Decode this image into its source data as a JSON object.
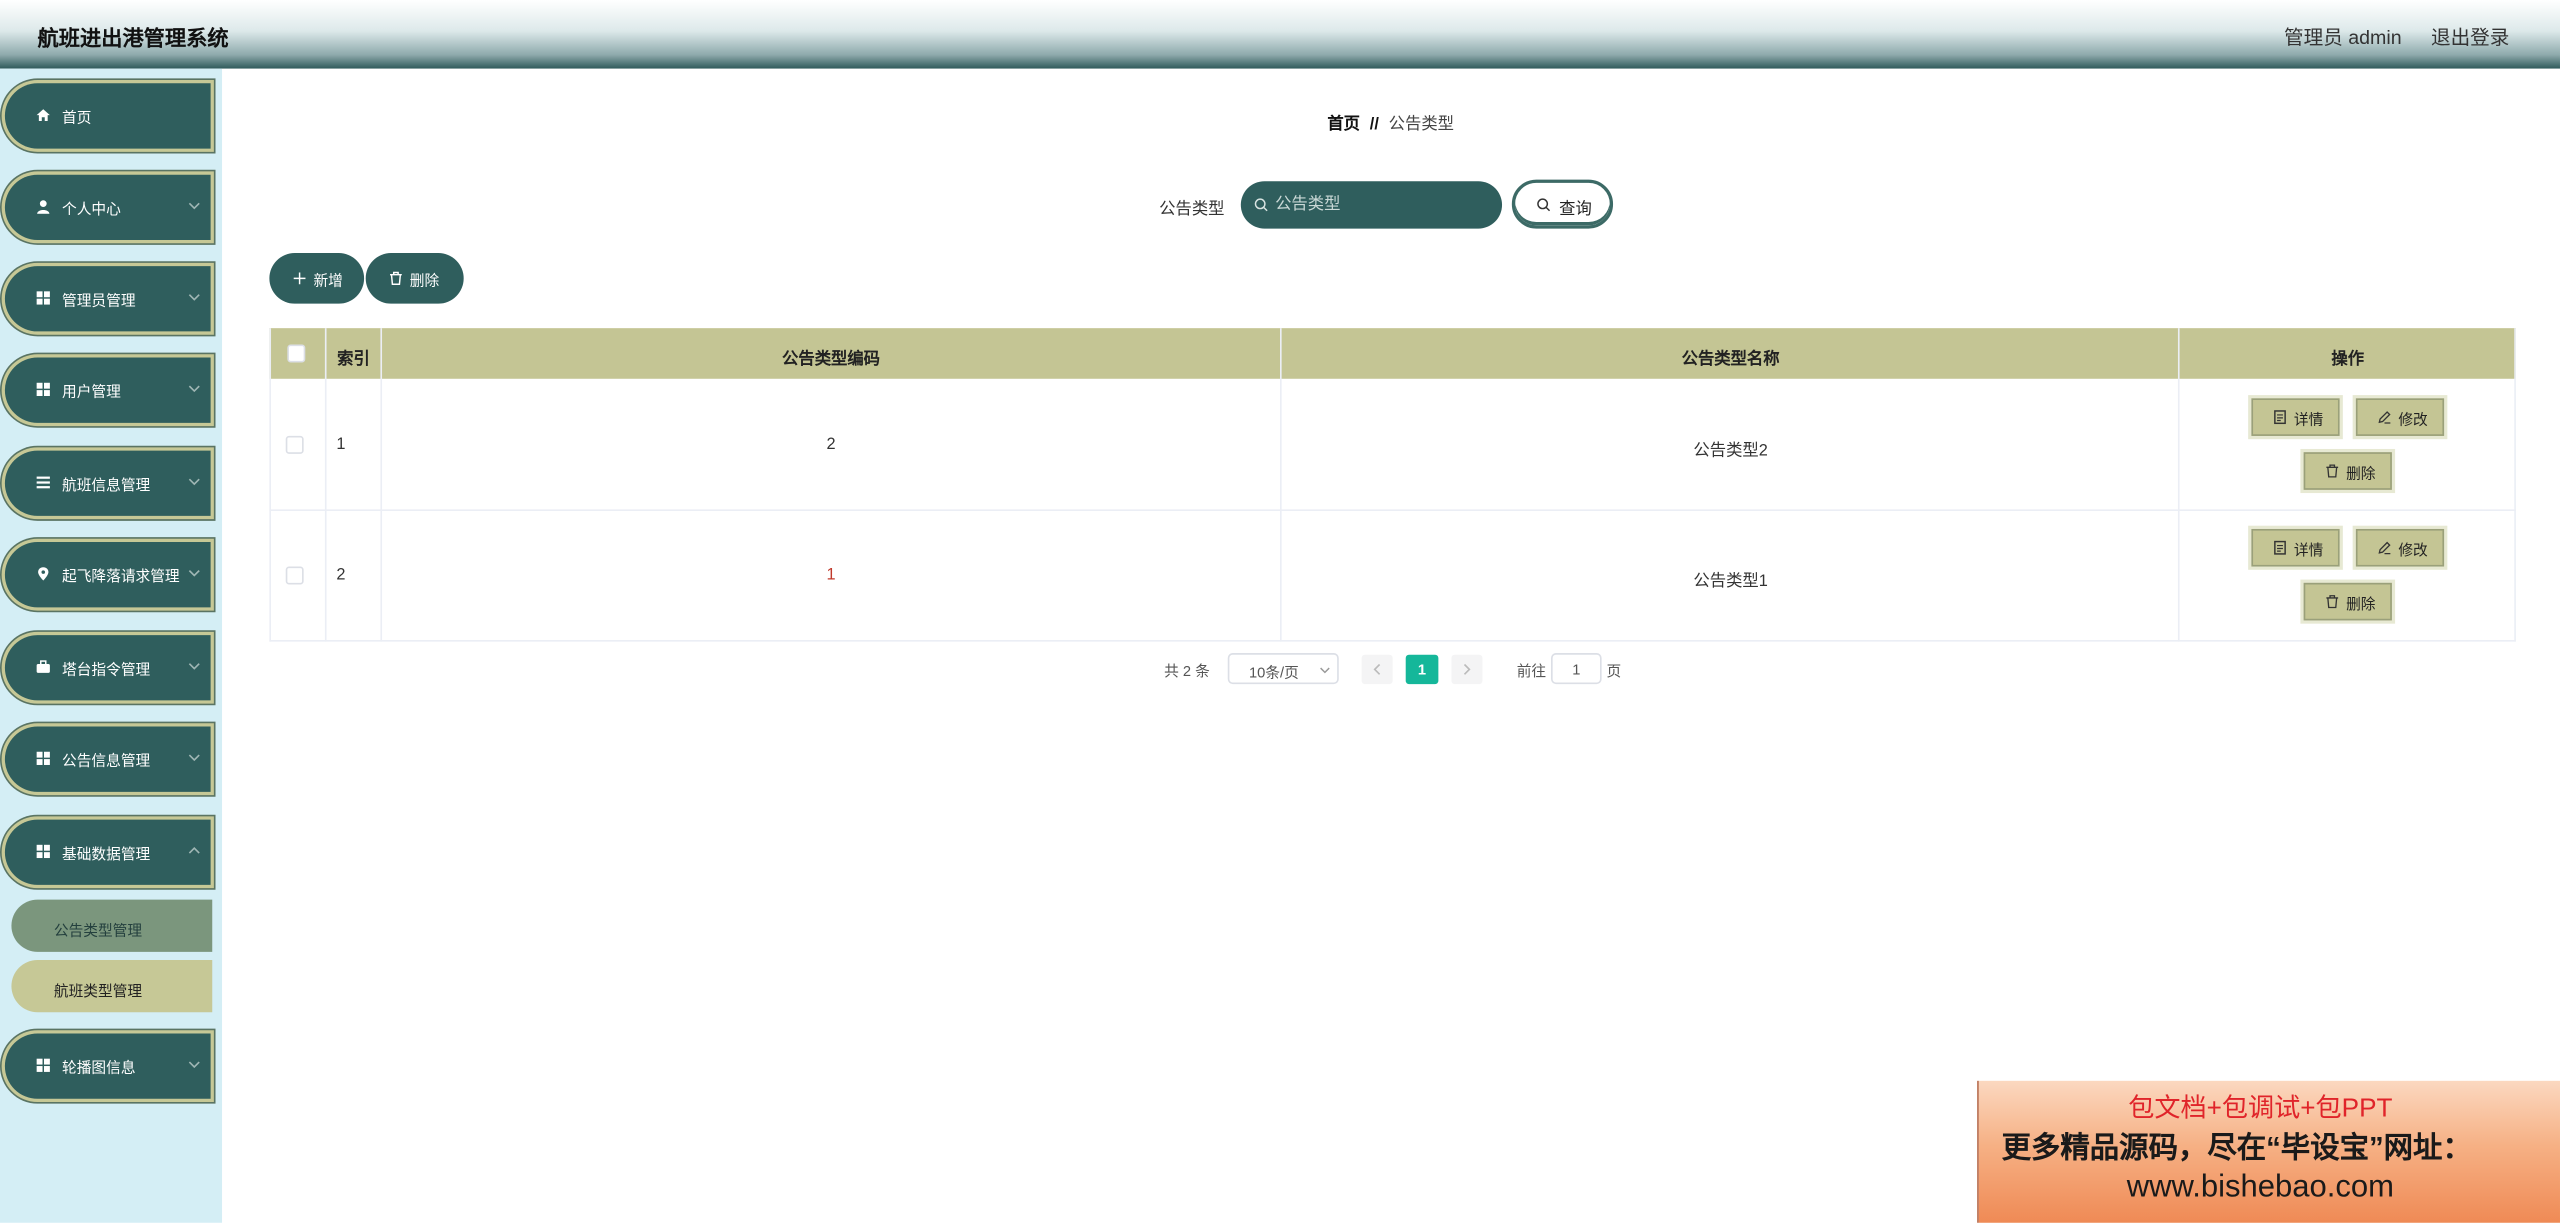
{
  "header": {
    "title": "航班进出港管理系统",
    "admin_label": "管理员 admin",
    "logout_label": "退出登录"
  },
  "sidebar": {
    "items": [
      {
        "label": "首页",
        "icon": "home-icon"
      },
      {
        "label": "个人中心",
        "icon": "user-icon"
      },
      {
        "label": "管理员管理",
        "icon": "grid-icon"
      },
      {
        "label": "用户管理",
        "icon": "grid-icon"
      },
      {
        "label": "航班信息管理",
        "icon": "list-icon"
      },
      {
        "label": "起飞降落请求管理",
        "icon": "location-pin-icon"
      },
      {
        "label": "塔台指令管理",
        "icon": "briefcase-icon"
      },
      {
        "label": "公告信息管理",
        "icon": "grid-icon"
      },
      {
        "label": "基础数据管理",
        "icon": "grid-icon"
      },
      {
        "label": "轮播图信息",
        "icon": "grid-icon"
      }
    ],
    "submenu": [
      {
        "label": "公告类型管理",
        "active": true
      },
      {
        "label": "航班类型管理",
        "active": false
      }
    ]
  },
  "breadcrumb": {
    "home": "首页",
    "separator": "//",
    "current": "公告类型"
  },
  "search": {
    "label": "公告类型",
    "placeholder": "公告类型",
    "button_label": "查询"
  },
  "toolbar": {
    "add_label": "新增",
    "delete_label": "删除"
  },
  "table": {
    "columns": [
      "索引",
      "公告类型编码",
      "公告类型名称",
      "操作"
    ],
    "rows": [
      {
        "index": "1",
        "code": "2",
        "name": "公告类型2"
      },
      {
        "index": "2",
        "code": "1",
        "name": "公告类型1"
      }
    ],
    "row_actions": {
      "detail": "详情",
      "edit": "修改",
      "delete": "删除"
    }
  },
  "pagination": {
    "total": "共 2 条",
    "page_size": "10条/页",
    "current_page": "1",
    "goto_label": "前往",
    "goto_value": "1",
    "page_unit": "页"
  },
  "ad_banner": {
    "line1": "包文档+包调试+包PPT",
    "line2": "更多精品源码，尽在“毕设宝”网址：",
    "line3": "www.bishebao.com"
  },
  "colors": {
    "primary": "#2f5e5d",
    "table_header": "#c4c594",
    "submenu_active": "#7b967d",
    "submenu_normal": "#c6c896",
    "sidebar_bg": "#d4eef5",
    "page_active": "#15b79a"
  }
}
